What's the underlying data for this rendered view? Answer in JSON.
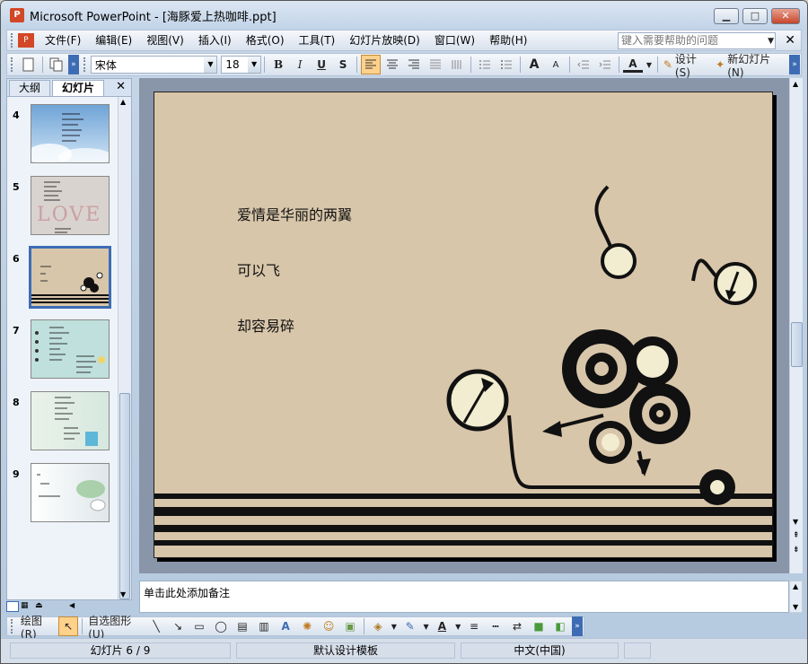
{
  "window": {
    "title": "Microsoft PowerPoint - [海豚爱上热咖啡.ppt]"
  },
  "menu": {
    "items": [
      "文件(F)",
      "编辑(E)",
      "视图(V)",
      "插入(I)",
      "格式(O)",
      "工具(T)",
      "幻灯片放映(D)",
      "窗口(W)",
      "帮助(H)"
    ],
    "help_placeholder": "键入需要帮助的问题"
  },
  "toolbar": {
    "font": "宋体",
    "size": "18",
    "bold": "B",
    "italic": "I",
    "underline": "U",
    "shadow": "S",
    "grow_font": "A",
    "shrink_font": "A",
    "font_color": "A",
    "design": "设计(S)",
    "new_slide": "新幻灯片(N)"
  },
  "panel": {
    "tabs": [
      "大纲",
      "幻灯片"
    ],
    "slides": [
      {
        "num": "4",
        "bg": "#9ec3e6"
      },
      {
        "num": "5",
        "bg": "#d9d3cf",
        "text": "LOVE"
      },
      {
        "num": "6",
        "bg": "#d8c6aa",
        "selected": true
      },
      {
        "num": "7",
        "bg": "#bfe0dc"
      },
      {
        "num": "8",
        "bg": "#e4efe6"
      },
      {
        "num": "9",
        "bg": "#e8eef0"
      }
    ]
  },
  "slide": {
    "lines": [
      "爱情是华丽的两翼",
      "可以飞",
      "却容易碎"
    ]
  },
  "notes": {
    "placeholder": "单击此处添加备注"
  },
  "drawbar": {
    "draw": "绘图(R)",
    "autoshapes": "自选图形(U)"
  },
  "status": {
    "slide": "幻灯片 6 / 9",
    "template": "默认设计模板",
    "language": "中文(中国)"
  },
  "colors": {
    "accent": "#3d6cb4",
    "slide_bg": "#d8c6aa",
    "menu_bg": "#dbe6f3"
  }
}
